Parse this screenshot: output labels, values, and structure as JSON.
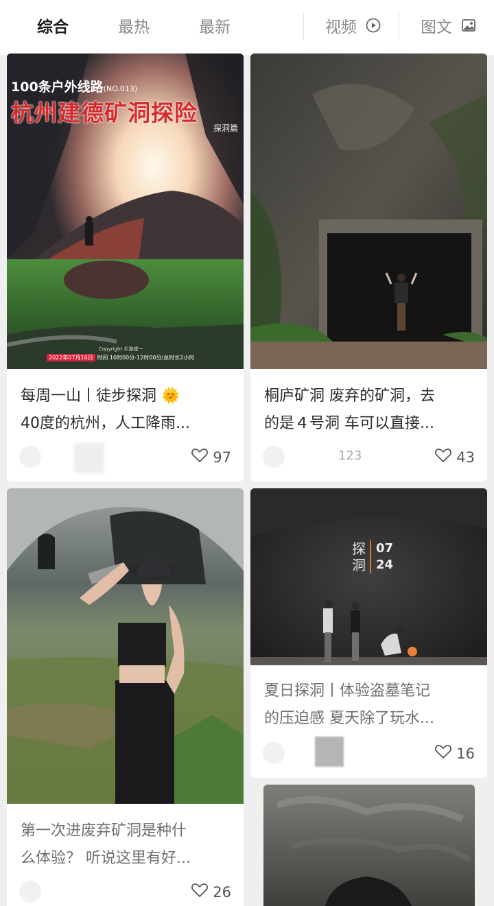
{
  "tabs": {
    "items": [
      "综合",
      "最热",
      "最新"
    ],
    "video_label": "视频",
    "image_text_label": "图文"
  },
  "cards": [
    {
      "overlay_subtitle": "100条户外线路",
      "overlay_no": "(NO.013)",
      "overlay_title": "杭州建德矿洞探险",
      "overlay_tag": "探洞篇",
      "overlay_copyright": "Copyright ©游咸一",
      "overlay_date": "2022年07月16日",
      "overlay_time": "时间 10时00分-12时00分/总时长2小时",
      "title_line1": "每周一山丨徒步探洞 🌞",
      "title_line2": "40度的杭州，人工降雨...",
      "author": "",
      "likes": "97"
    },
    {
      "title_line1": "桐庐矿洞 废弃的矿洞，去",
      "title_line2": "的是４号洞 车可以直接...",
      "author": "123",
      "likes": "43"
    },
    {
      "title_line1": "第一次进废弃矿洞是种什",
      "title_line2": "么体验？ 听说这里有好...",
      "author": "",
      "likes": "26"
    },
    {
      "overlay_left_top": "探",
      "overlay_left_bottom": "洞",
      "overlay_right_top": "07",
      "overlay_right_bottom": "24",
      "title_line1": "夏日探洞丨体验盗墓笔记",
      "title_line2": "的压迫感 夏天除了玩水...",
      "author": "",
      "likes": "16"
    }
  ],
  "colors": {
    "accent_red": "#d62a2a",
    "date_badge": "#d6223a"
  }
}
